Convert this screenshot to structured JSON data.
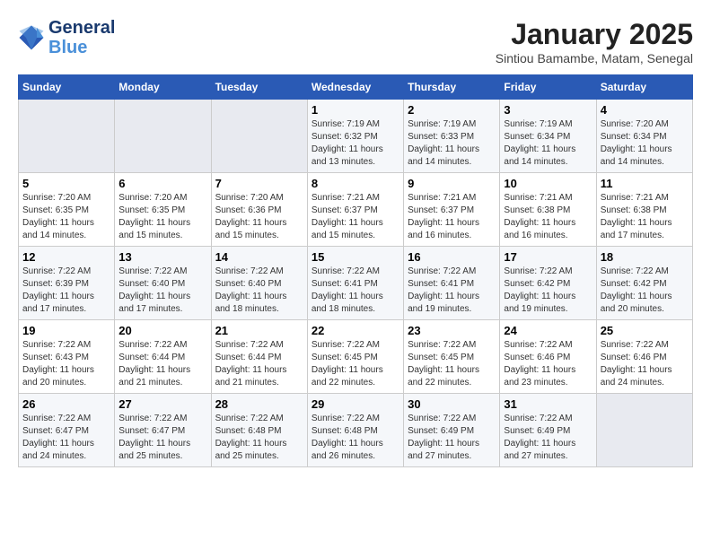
{
  "header": {
    "logo_line1": "General",
    "logo_line2": "Blue",
    "month": "January 2025",
    "location": "Sintiou Bamambe, Matam, Senegal"
  },
  "days_of_week": [
    "Sunday",
    "Monday",
    "Tuesday",
    "Wednesday",
    "Thursday",
    "Friday",
    "Saturday"
  ],
  "weeks": [
    [
      {
        "day": "",
        "info": ""
      },
      {
        "day": "",
        "info": ""
      },
      {
        "day": "",
        "info": ""
      },
      {
        "day": "1",
        "info": "Sunrise: 7:19 AM\nSunset: 6:32 PM\nDaylight: 11 hours\nand 13 minutes."
      },
      {
        "day": "2",
        "info": "Sunrise: 7:19 AM\nSunset: 6:33 PM\nDaylight: 11 hours\nand 14 minutes."
      },
      {
        "day": "3",
        "info": "Sunrise: 7:19 AM\nSunset: 6:34 PM\nDaylight: 11 hours\nand 14 minutes."
      },
      {
        "day": "4",
        "info": "Sunrise: 7:20 AM\nSunset: 6:34 PM\nDaylight: 11 hours\nand 14 minutes."
      }
    ],
    [
      {
        "day": "5",
        "info": "Sunrise: 7:20 AM\nSunset: 6:35 PM\nDaylight: 11 hours\nand 14 minutes."
      },
      {
        "day": "6",
        "info": "Sunrise: 7:20 AM\nSunset: 6:35 PM\nDaylight: 11 hours\nand 15 minutes."
      },
      {
        "day": "7",
        "info": "Sunrise: 7:20 AM\nSunset: 6:36 PM\nDaylight: 11 hours\nand 15 minutes."
      },
      {
        "day": "8",
        "info": "Sunrise: 7:21 AM\nSunset: 6:37 PM\nDaylight: 11 hours\nand 15 minutes."
      },
      {
        "day": "9",
        "info": "Sunrise: 7:21 AM\nSunset: 6:37 PM\nDaylight: 11 hours\nand 16 minutes."
      },
      {
        "day": "10",
        "info": "Sunrise: 7:21 AM\nSunset: 6:38 PM\nDaylight: 11 hours\nand 16 minutes."
      },
      {
        "day": "11",
        "info": "Sunrise: 7:21 AM\nSunset: 6:38 PM\nDaylight: 11 hours\nand 17 minutes."
      }
    ],
    [
      {
        "day": "12",
        "info": "Sunrise: 7:22 AM\nSunset: 6:39 PM\nDaylight: 11 hours\nand 17 minutes."
      },
      {
        "day": "13",
        "info": "Sunrise: 7:22 AM\nSunset: 6:40 PM\nDaylight: 11 hours\nand 17 minutes."
      },
      {
        "day": "14",
        "info": "Sunrise: 7:22 AM\nSunset: 6:40 PM\nDaylight: 11 hours\nand 18 minutes."
      },
      {
        "day": "15",
        "info": "Sunrise: 7:22 AM\nSunset: 6:41 PM\nDaylight: 11 hours\nand 18 minutes."
      },
      {
        "day": "16",
        "info": "Sunrise: 7:22 AM\nSunset: 6:41 PM\nDaylight: 11 hours\nand 19 minutes."
      },
      {
        "day": "17",
        "info": "Sunrise: 7:22 AM\nSunset: 6:42 PM\nDaylight: 11 hours\nand 19 minutes."
      },
      {
        "day": "18",
        "info": "Sunrise: 7:22 AM\nSunset: 6:42 PM\nDaylight: 11 hours\nand 20 minutes."
      }
    ],
    [
      {
        "day": "19",
        "info": "Sunrise: 7:22 AM\nSunset: 6:43 PM\nDaylight: 11 hours\nand 20 minutes."
      },
      {
        "day": "20",
        "info": "Sunrise: 7:22 AM\nSunset: 6:44 PM\nDaylight: 11 hours\nand 21 minutes."
      },
      {
        "day": "21",
        "info": "Sunrise: 7:22 AM\nSunset: 6:44 PM\nDaylight: 11 hours\nand 21 minutes."
      },
      {
        "day": "22",
        "info": "Sunrise: 7:22 AM\nSunset: 6:45 PM\nDaylight: 11 hours\nand 22 minutes."
      },
      {
        "day": "23",
        "info": "Sunrise: 7:22 AM\nSunset: 6:45 PM\nDaylight: 11 hours\nand 22 minutes."
      },
      {
        "day": "24",
        "info": "Sunrise: 7:22 AM\nSunset: 6:46 PM\nDaylight: 11 hours\nand 23 minutes."
      },
      {
        "day": "25",
        "info": "Sunrise: 7:22 AM\nSunset: 6:46 PM\nDaylight: 11 hours\nand 24 minutes."
      }
    ],
    [
      {
        "day": "26",
        "info": "Sunrise: 7:22 AM\nSunset: 6:47 PM\nDaylight: 11 hours\nand 24 minutes."
      },
      {
        "day": "27",
        "info": "Sunrise: 7:22 AM\nSunset: 6:47 PM\nDaylight: 11 hours\nand 25 minutes."
      },
      {
        "day": "28",
        "info": "Sunrise: 7:22 AM\nSunset: 6:48 PM\nDaylight: 11 hours\nand 25 minutes."
      },
      {
        "day": "29",
        "info": "Sunrise: 7:22 AM\nSunset: 6:48 PM\nDaylight: 11 hours\nand 26 minutes."
      },
      {
        "day": "30",
        "info": "Sunrise: 7:22 AM\nSunset: 6:49 PM\nDaylight: 11 hours\nand 27 minutes."
      },
      {
        "day": "31",
        "info": "Sunrise: 7:22 AM\nSunset: 6:49 PM\nDaylight: 11 hours\nand 27 minutes."
      },
      {
        "day": "",
        "info": ""
      }
    ]
  ]
}
